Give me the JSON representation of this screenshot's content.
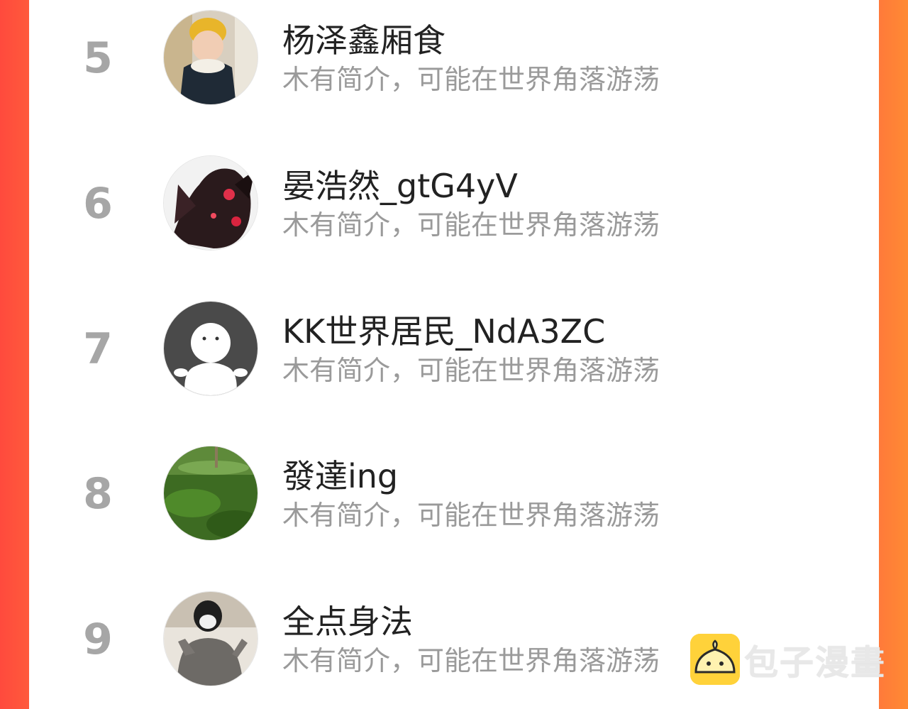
{
  "ranking": [
    {
      "rank": "5",
      "name": "杨泽鑫厢食",
      "description": "木有简介，可能在世界角落游荡",
      "avatar": "baby-photo-avatar"
    },
    {
      "rank": "6",
      "name": "晏浩然_gtG4yV",
      "description": "木有简介，可能在世界角落游荡",
      "avatar": "dark-figure-avatar"
    },
    {
      "rank": "7",
      "name": "KK世界居民_NdA3ZC",
      "description": "木有简介，可能在世界角落游荡",
      "avatar": "default-ghost-avatar"
    },
    {
      "rank": "8",
      "name": "發達ing",
      "description": "木有简介，可能在世界角落游荡",
      "avatar": "grass-photo-avatar"
    },
    {
      "rank": "9",
      "name": "全点身法",
      "description": "木有简介，可能在世界角落游荡",
      "avatar": "person-photo-avatar"
    }
  ],
  "watermark": {
    "text": "包子漫畫",
    "icon": "bun-logo-icon"
  },
  "colors": {
    "left_border": "#ff4a3d",
    "right_border": "#ff8a33",
    "rank": "#a6a6a6",
    "name": "#222222",
    "description": "#9a9a9a",
    "logo": "#ffd23a"
  }
}
